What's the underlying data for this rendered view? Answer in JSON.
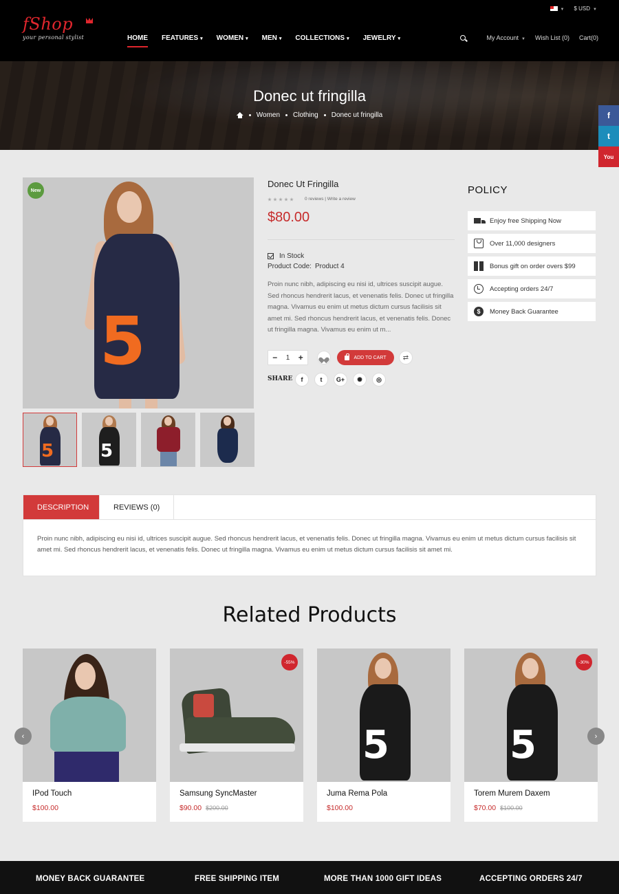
{
  "header": {
    "logo": "fShop",
    "tagline": "your personal stylist",
    "currency": "$ USD",
    "nav": [
      "HOME",
      "FEATURES",
      "WOMEN",
      "MEN",
      "COLLECTIONS",
      "JEWELRY"
    ],
    "account": "My Account",
    "wishlist": "Wish List (0)",
    "cart": "Cart(0)"
  },
  "banner": {
    "title": "Donec ut fringilla",
    "breadcrumbs": [
      "Women",
      "Clothing",
      "Donec ut fringilla"
    ]
  },
  "social_side": [
    "f",
    "t",
    "You"
  ],
  "product": {
    "badge": "New",
    "title": "Donec Ut Fringilla",
    "reviews": "0 reviews | Write a review",
    "price": "$80.00",
    "stock": "In Stock",
    "code_label": "Product Code:",
    "code_value": "Product 4",
    "description": "Proin nunc nibh, adipiscing eu nisi id, ultrices suscipit augue. Sed rhoncus hendrerit lacus, et venenatis felis. Donec ut fringilla magna. Vivamus eu enim ut metus dictum cursus facilisis sit amet mi. Sed rhoncus hendrerit lacus, et venenatis felis. Donec ut fringilla magna. Vivamus eu enim ut m...",
    "qty": "1",
    "qty_minus": "−",
    "qty_plus": "+",
    "add_to_cart": "ADD TO CART",
    "share_label": "SHARE",
    "share_icons": [
      "f",
      "t",
      "G+",
      "✺",
      "◎"
    ]
  },
  "policy": {
    "title": "POLICY",
    "items": [
      "Enjoy free Shipping Now",
      "Over 11,000 designers",
      "Bonus gift on order overs $99",
      "Accepting orders 24/7",
      "Money Back Guarantee"
    ],
    "icons": [
      "truck-icon",
      "shopping-bag-icon",
      "gift-icon",
      "clock-icon",
      "dollar-icon"
    ],
    "dollar_glyph": "$"
  },
  "tabs": {
    "items": [
      "DESCRIPTION",
      "REVIEWS (0)"
    ],
    "content": "Proin nunc nibh, adipiscing eu nisi id, ultrices suscipit augue. Sed rhoncus hendrerit lacus, et venenatis felis. Donec ut fringilla magna. Vivamus eu enim ut metus dictum cursus facilisis sit amet mi. Sed rhoncus hendrerit lacus, et venenatis felis. Donec ut fringilla magna. Vivamus eu enim ut metus dictum cursus facilisis sit amet mi."
  },
  "related": {
    "title": "Related Products",
    "products": [
      {
        "name": "IPod Touch",
        "price": "$100.00",
        "old": "",
        "discount": ""
      },
      {
        "name": "Samsung SyncMaster",
        "price": "$90.00",
        "old": "$200.00",
        "discount": "-55%"
      },
      {
        "name": "Juma Rema Pola",
        "price": "$100.00",
        "old": "",
        "discount": ""
      },
      {
        "name": "Torem Murem Daxem",
        "price": "$70.00",
        "old": "$100.00",
        "discount": "-30%"
      }
    ],
    "prev": "‹",
    "next": "›"
  },
  "footer": {
    "columns": [
      "MONEY BACK GUARANTEE",
      "FREE SHIPPING ITEM",
      "MORE THAN 1000 GIFT IDEAS",
      "ACCEPTING ORDERS 24/7"
    ]
  },
  "colors": {
    "accent": "#d23a3a",
    "header_bg": "#000000",
    "new_badge": "#5c9b3f",
    "facebook": "#3b5998",
    "twitter": "#1c8dbb",
    "youtube": "#d0262e"
  }
}
